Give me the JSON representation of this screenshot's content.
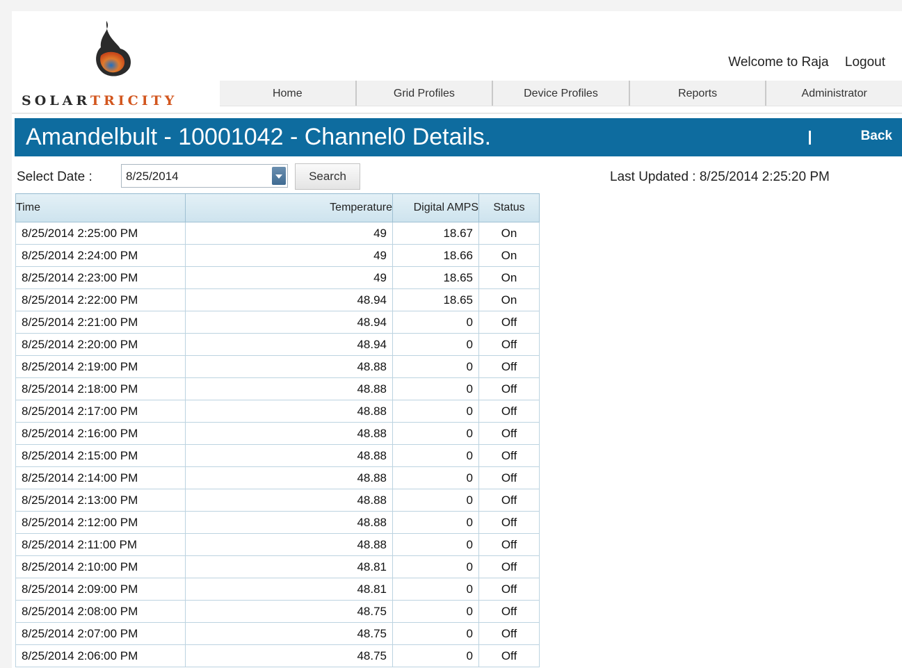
{
  "brand": {
    "part1": "Solar",
    "part2": "Tricity"
  },
  "user": {
    "welcome": "Welcome to Raja",
    "logout": "Logout"
  },
  "nav": [
    "Home",
    "Grid Profiles",
    "Device Profiles",
    "Reports",
    "Administrator"
  ],
  "titlebar": {
    "title": "Amandelbult - 10001042 - Channel0 Details.",
    "separator": "I",
    "back": "Back"
  },
  "filter": {
    "label": "Select Date :",
    "date": "8/25/2014",
    "search": "Search"
  },
  "last_updated": "Last Updated : 8/25/2014 2:25:20 PM",
  "table": {
    "headers": [
      "Time",
      "Temperature",
      "Digital AMPS",
      "Status"
    ],
    "rows": [
      [
        "8/25/2014 2:25:00 PM",
        "49",
        "18.67",
        "On"
      ],
      [
        "8/25/2014 2:24:00 PM",
        "49",
        "18.66",
        "On"
      ],
      [
        "8/25/2014 2:23:00 PM",
        "49",
        "18.65",
        "On"
      ],
      [
        "8/25/2014 2:22:00 PM",
        "48.94",
        "18.65",
        "On"
      ],
      [
        "8/25/2014 2:21:00 PM",
        "48.94",
        "0",
        "Off"
      ],
      [
        "8/25/2014 2:20:00 PM",
        "48.94",
        "0",
        "Off"
      ],
      [
        "8/25/2014 2:19:00 PM",
        "48.88",
        "0",
        "Off"
      ],
      [
        "8/25/2014 2:18:00 PM",
        "48.88",
        "0",
        "Off"
      ],
      [
        "8/25/2014 2:17:00 PM",
        "48.88",
        "0",
        "Off"
      ],
      [
        "8/25/2014 2:16:00 PM",
        "48.88",
        "0",
        "Off"
      ],
      [
        "8/25/2014 2:15:00 PM",
        "48.88",
        "0",
        "Off"
      ],
      [
        "8/25/2014 2:14:00 PM",
        "48.88",
        "0",
        "Off"
      ],
      [
        "8/25/2014 2:13:00 PM",
        "48.88",
        "0",
        "Off"
      ],
      [
        "8/25/2014 2:12:00 PM",
        "48.88",
        "0",
        "Off"
      ],
      [
        "8/25/2014 2:11:00 PM",
        "48.88",
        "0",
        "Off"
      ],
      [
        "8/25/2014 2:10:00 PM",
        "48.81",
        "0",
        "Off"
      ],
      [
        "8/25/2014 2:09:00 PM",
        "48.81",
        "0",
        "Off"
      ],
      [
        "8/25/2014 2:08:00 PM",
        "48.75",
        "0",
        "Off"
      ],
      [
        "8/25/2014 2:07:00 PM",
        "48.75",
        "0",
        "Off"
      ],
      [
        "8/25/2014 2:06:00 PM",
        "48.75",
        "0",
        "Off"
      ]
    ]
  },
  "colors": {
    "titlebar_bg": "#0e6c9f",
    "brand_orange": "#d2561e",
    "brand_dark": "#2a2a2a"
  }
}
